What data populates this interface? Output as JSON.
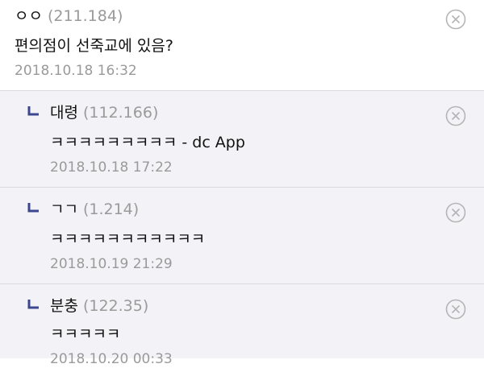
{
  "comments": [
    {
      "nick": "ㅇㅇ",
      "ip": "(211.184)",
      "text": "편의점이 선죽교에 있음?",
      "date": "2018.10.18 16:32"
    }
  ],
  "replies": [
    {
      "nick": "대령",
      "ip": "(112.166)",
      "text": "ㅋㅋㅋㅋㅋㅋㅋㅋㅋ - dc App",
      "date": "2018.10.18 17:22"
    },
    {
      "nick": "ㄱㄱ",
      "ip": "(1.214)",
      "text": "ㅋㅋㅋㅋㅋㅋㅋㅋㅋㅋㅋ",
      "date": "2018.10.19 21:29"
    },
    {
      "nick": "분충",
      "ip": "(122.35)",
      "text": "ㅋㅋㅋㅋㅋ",
      "date": "2018.10.20 00:33"
    }
  ],
  "icons": {
    "reply": "reply-arrow-icon",
    "delete": "close-circle-icon"
  },
  "colors": {
    "reply_background": "#f3f3f7",
    "reply_icon": "#3b4890",
    "meta_text": "#9a9a9a"
  }
}
